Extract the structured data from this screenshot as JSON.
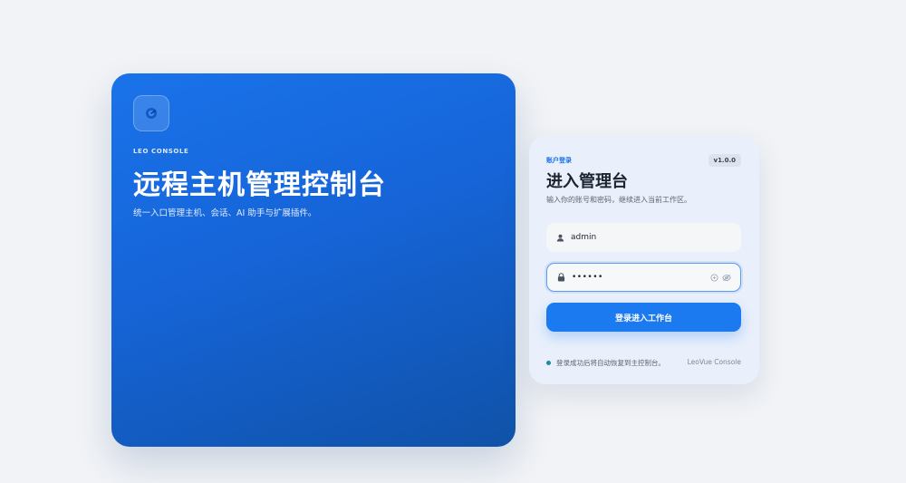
{
  "hero": {
    "brand": "LEO CONSOLE",
    "title": "远程主机管理控制台",
    "subtitle": "统一入口管理主机、会话、AI 助手与扩展插件。",
    "logo_icon": "gauge-logo-icon"
  },
  "login": {
    "tag": "账户登录",
    "version": "v1.0.0",
    "title": "进入管理台",
    "description": "输入你的账号和密码，继续进入当前工作区。",
    "username": {
      "value": "admin",
      "icon": "user-icon"
    },
    "password": {
      "value": "••••••",
      "icon": "lock-icon",
      "trailing_icons": [
        "clear-icon",
        "eye-icon"
      ]
    },
    "submit_label": "登录进入工作台",
    "status_text": "登录成功后将自动恢复到主控制台。",
    "footer_brand": "LeoVue Console"
  },
  "colors": {
    "accent": "#1b7aef",
    "hero_gradient_start": "#1a73ea",
    "hero_gradient_end": "#0f52a8",
    "page_background": "#f1f3f6",
    "status_dot": "#1f8a9a"
  }
}
